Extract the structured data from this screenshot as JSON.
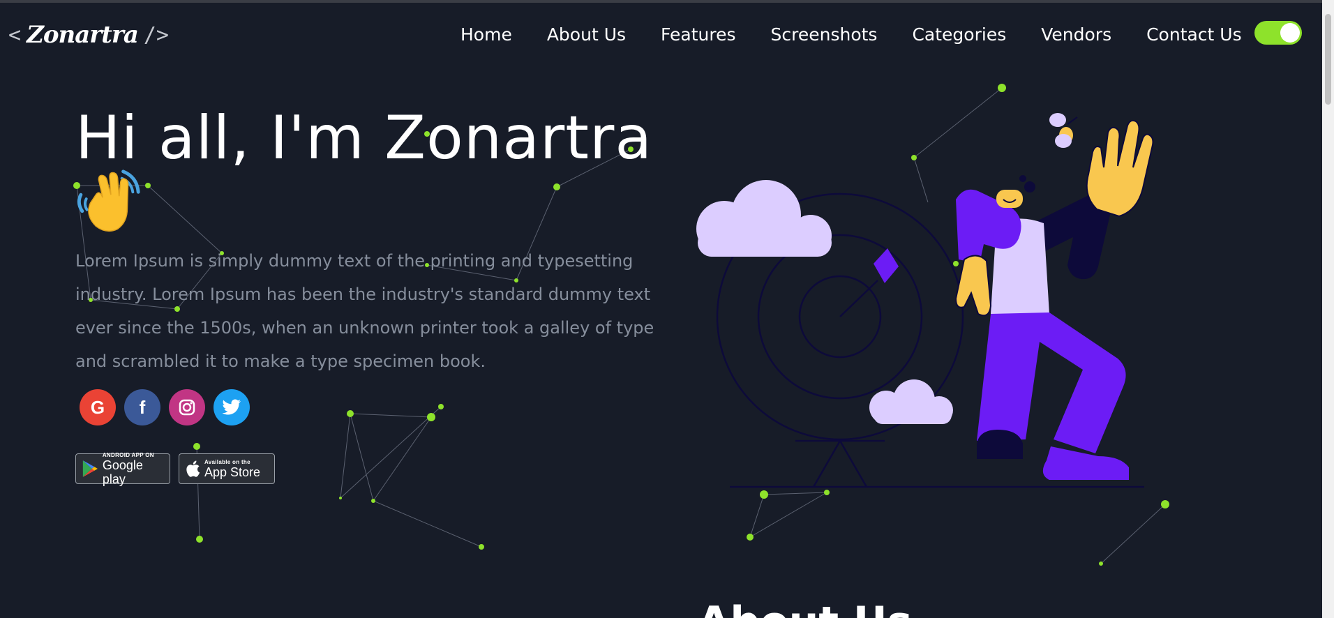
{
  "header": {
    "logo": {
      "open_bracket": "<",
      "name": "Zonartra",
      "close_bracket": "/>"
    },
    "nav": [
      {
        "label": "Home"
      },
      {
        "label": "About Us"
      },
      {
        "label": "Features"
      },
      {
        "label": "Screenshots"
      },
      {
        "label": "Categories"
      },
      {
        "label": "Vendors"
      },
      {
        "label": "Contact Us"
      }
    ],
    "theme_toggle": {
      "on": true,
      "accent": "#8ee22b"
    }
  },
  "hero": {
    "title": "Hi all, I'm Zonartra",
    "wave_emoji": "👋",
    "description": "Lorem Ipsum is simply dummy text of the printing and typesetting industry. Lorem Ipsum has been the industry's standard dummy text ever since the 1500s, when an unknown printer took a galley of type and scrambled it to make a type specimen book.",
    "socials": [
      {
        "icon": "google-icon",
        "glyph": "G",
        "color": "#ea4335"
      },
      {
        "icon": "facebook-icon",
        "glyph": "f",
        "color": "#3b5998"
      },
      {
        "icon": "instagram-icon",
        "glyph": "◎",
        "color": "#c13584"
      },
      {
        "icon": "twitter-icon",
        "glyph": "🐦",
        "color": "#1da1f2"
      }
    ],
    "stores": {
      "google_play": {
        "small": "ANDROID APP ON",
        "big": "Google play"
      },
      "app_store": {
        "small": "Available on the",
        "big": "App Store"
      }
    }
  },
  "next_section": {
    "heading": "About Us"
  },
  "colors": {
    "background": "#171c28",
    "accent": "#8ee22b",
    "text_muted": "#868e9c",
    "purple": "#6c1cf5",
    "lavender": "#dccdff",
    "yellow": "#f9c74f"
  }
}
